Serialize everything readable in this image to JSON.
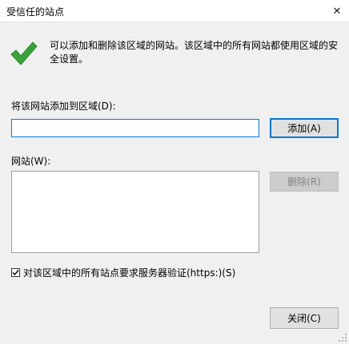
{
  "window": {
    "title": "受信任的站点",
    "close_glyph": "✕"
  },
  "info": {
    "icon": "checkmark-icon",
    "text": "可以添加和删除该区域的网站。该区域中的所有网站都使用区域的安全设置。"
  },
  "add_site": {
    "label": "将该网站添加到区域(D):",
    "value": "",
    "placeholder": "",
    "add_button": "添加(A)"
  },
  "sites": {
    "label": "网站(W):",
    "items": [],
    "remove_button": "删除(R)"
  },
  "https_option": {
    "checked": true,
    "label": "对该区域中的所有站点要求服务器验证(https:)(S)"
  },
  "footer": {
    "close_button": "关闭(C)"
  },
  "colors": {
    "accent": "#0078d7",
    "check": "#3aa23a"
  }
}
